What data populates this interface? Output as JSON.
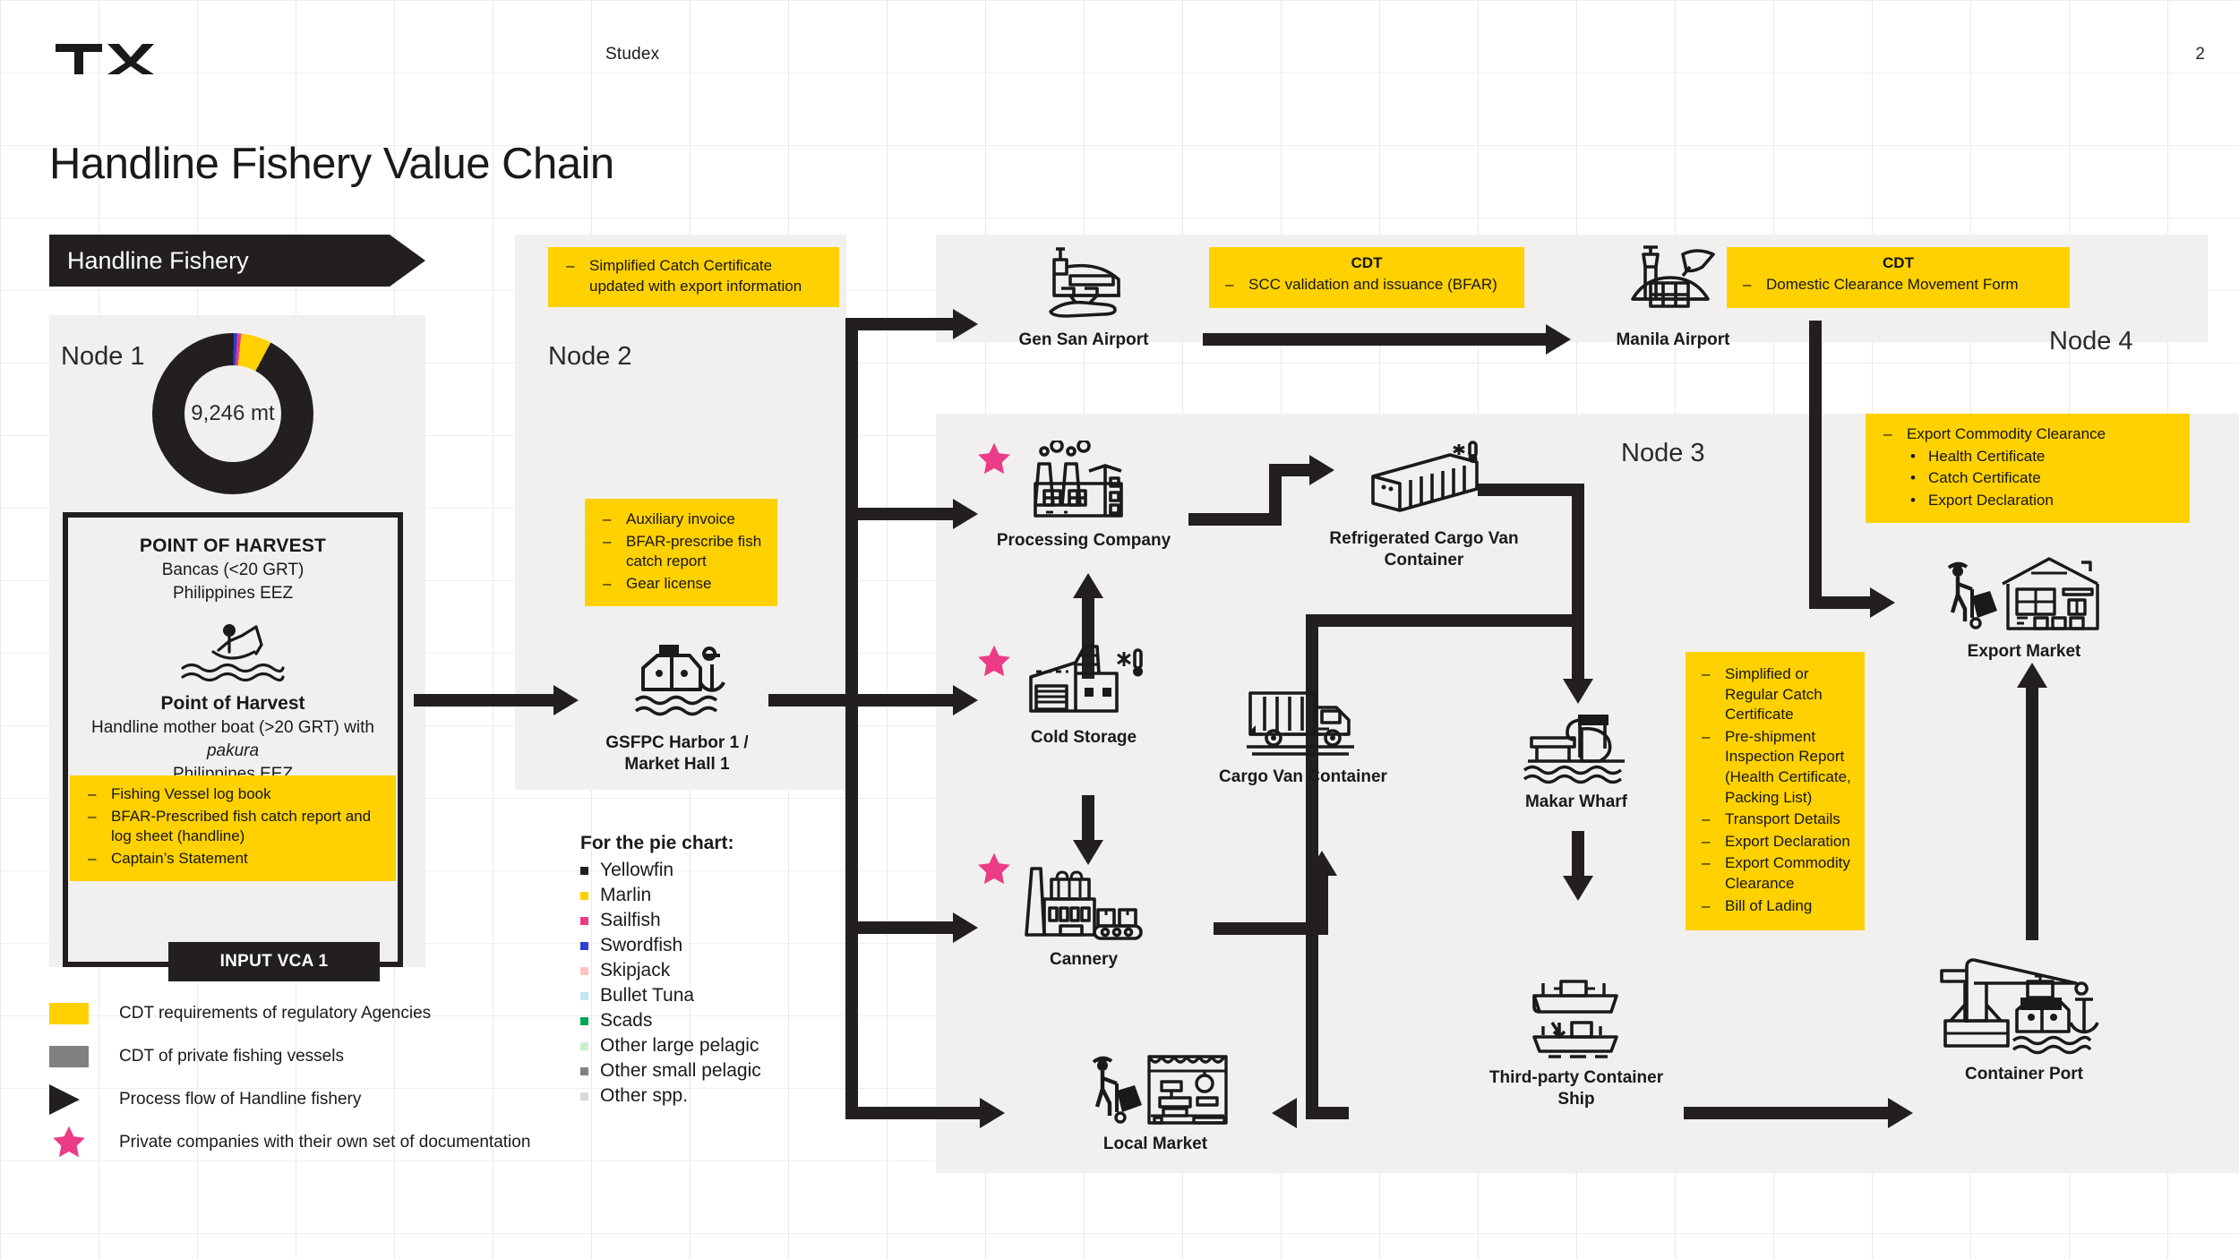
{
  "header": {
    "logo": "TX",
    "project": "Studex",
    "page_number": "2",
    "title": "Handline Fishery Value Chain"
  },
  "banner": {
    "label": "Handline Fishery"
  },
  "nodes_labels": {
    "node1": "Node 1",
    "node2": "Node 2",
    "node3": "Node 3",
    "node4": "Node 4"
  },
  "donut": {
    "center_value": "9,246 mt"
  },
  "chart_data": {
    "type": "pie",
    "title": "For the pie chart:",
    "center_label": "9,246 mt",
    "total": 9246,
    "unit": "mt",
    "categories": [
      "Yellowfin",
      "Marlin",
      "Sailfish",
      "Swordfish",
      "Skipjack",
      "Bullet Tuna",
      "Scads",
      "Other large pelagic",
      "Other small pelagic",
      "Other spp."
    ],
    "colors": [
      "#231f20",
      "#ffd100",
      "#ec3c87",
      "#2f3fd0",
      "#fbc7bd",
      "#bfe8f5",
      "#00a651",
      "#c8f0cd",
      "#808080",
      "#d9d9d9"
    ],
    "values": [
      92.2,
      6.1,
      0.8,
      0.7,
      0.05,
      0.05,
      0.04,
      0.02,
      0.02,
      0.02
    ],
    "legend_position": "below-left",
    "grid": false
  },
  "point_of_harvest": {
    "title": "POINT OF HARVEST",
    "line1": "Bancas (<20 GRT)",
    "line2": "Philippines EEZ",
    "title2": "Point of Harvest",
    "line3": "Handline mother boat (>20 GRT) with",
    "line4": "pakura",
    "line5": "Philippines EEZ",
    "note_items": [
      "Fishing Vessel log book",
      "BFAR-Prescribed fish catch report and log sheet (handline)",
      "Captain’s Statement"
    ],
    "input_tag": "INPUT VCA 1"
  },
  "legend": {
    "items": [
      {
        "key": "yellow-swatch",
        "color": "#ffd100",
        "label": "CDT requirements of regulatory Agencies"
      },
      {
        "key": "grey-swatch",
        "color": "#808080",
        "label": "CDT of private fishing vessels"
      },
      {
        "key": "black-triangle",
        "color": "#231f20",
        "label": "Process flow of Handline fishery"
      },
      {
        "key": "pink-star",
        "color": "#ec3c87",
        "label": "Private companies with their own set of documentation"
      }
    ]
  },
  "notes": {
    "node2_top": {
      "items": [
        "Simplified Catch Certificate updated with export information"
      ]
    },
    "node2_mid": {
      "items": [
        "Auxiliary invoice",
        "BFAR-prescribe fish catch report",
        "Gear license"
      ]
    },
    "gensan_cdt": {
      "heading": "CDT",
      "items": [
        "SCC validation and issuance (BFAR)"
      ]
    },
    "manila_cdt": {
      "heading": "CDT",
      "items": [
        "Domestic Clearance Movement Form"
      ]
    },
    "export_clearance": {
      "items": [
        "Export Commodity Clearance"
      ],
      "sub_items": [
        "Health Certificate",
        "Catch Certificate",
        "Export Declaration"
      ]
    },
    "shipping_docs": {
      "items": [
        "Simplified or Regular Catch Certificate",
        "Pre-shipment Inspection Report (Health Certificate, Packing List)",
        "Transport Details",
        "Export Declaration",
        "Export Commodity Clearance",
        "Bill of Lading"
      ]
    }
  },
  "flow_nodes": {
    "harbor": "GSFPC Harbor 1 / Market Hall 1",
    "gensan_airport": "Gen San Airport",
    "manila_airport": "Manila Airport",
    "processing_company": "Processing Company",
    "reefer_container": "Refrigerated Cargo Van Container",
    "cold_storage": "Cold Storage",
    "cargo_van": "Cargo Van Container",
    "cannery": "Cannery",
    "makar_wharf": "Makar Wharf",
    "container_ship": "Third-party Container Ship",
    "local_market": "Local Market",
    "export_market": "Export Market",
    "container_port": "Container Port"
  }
}
